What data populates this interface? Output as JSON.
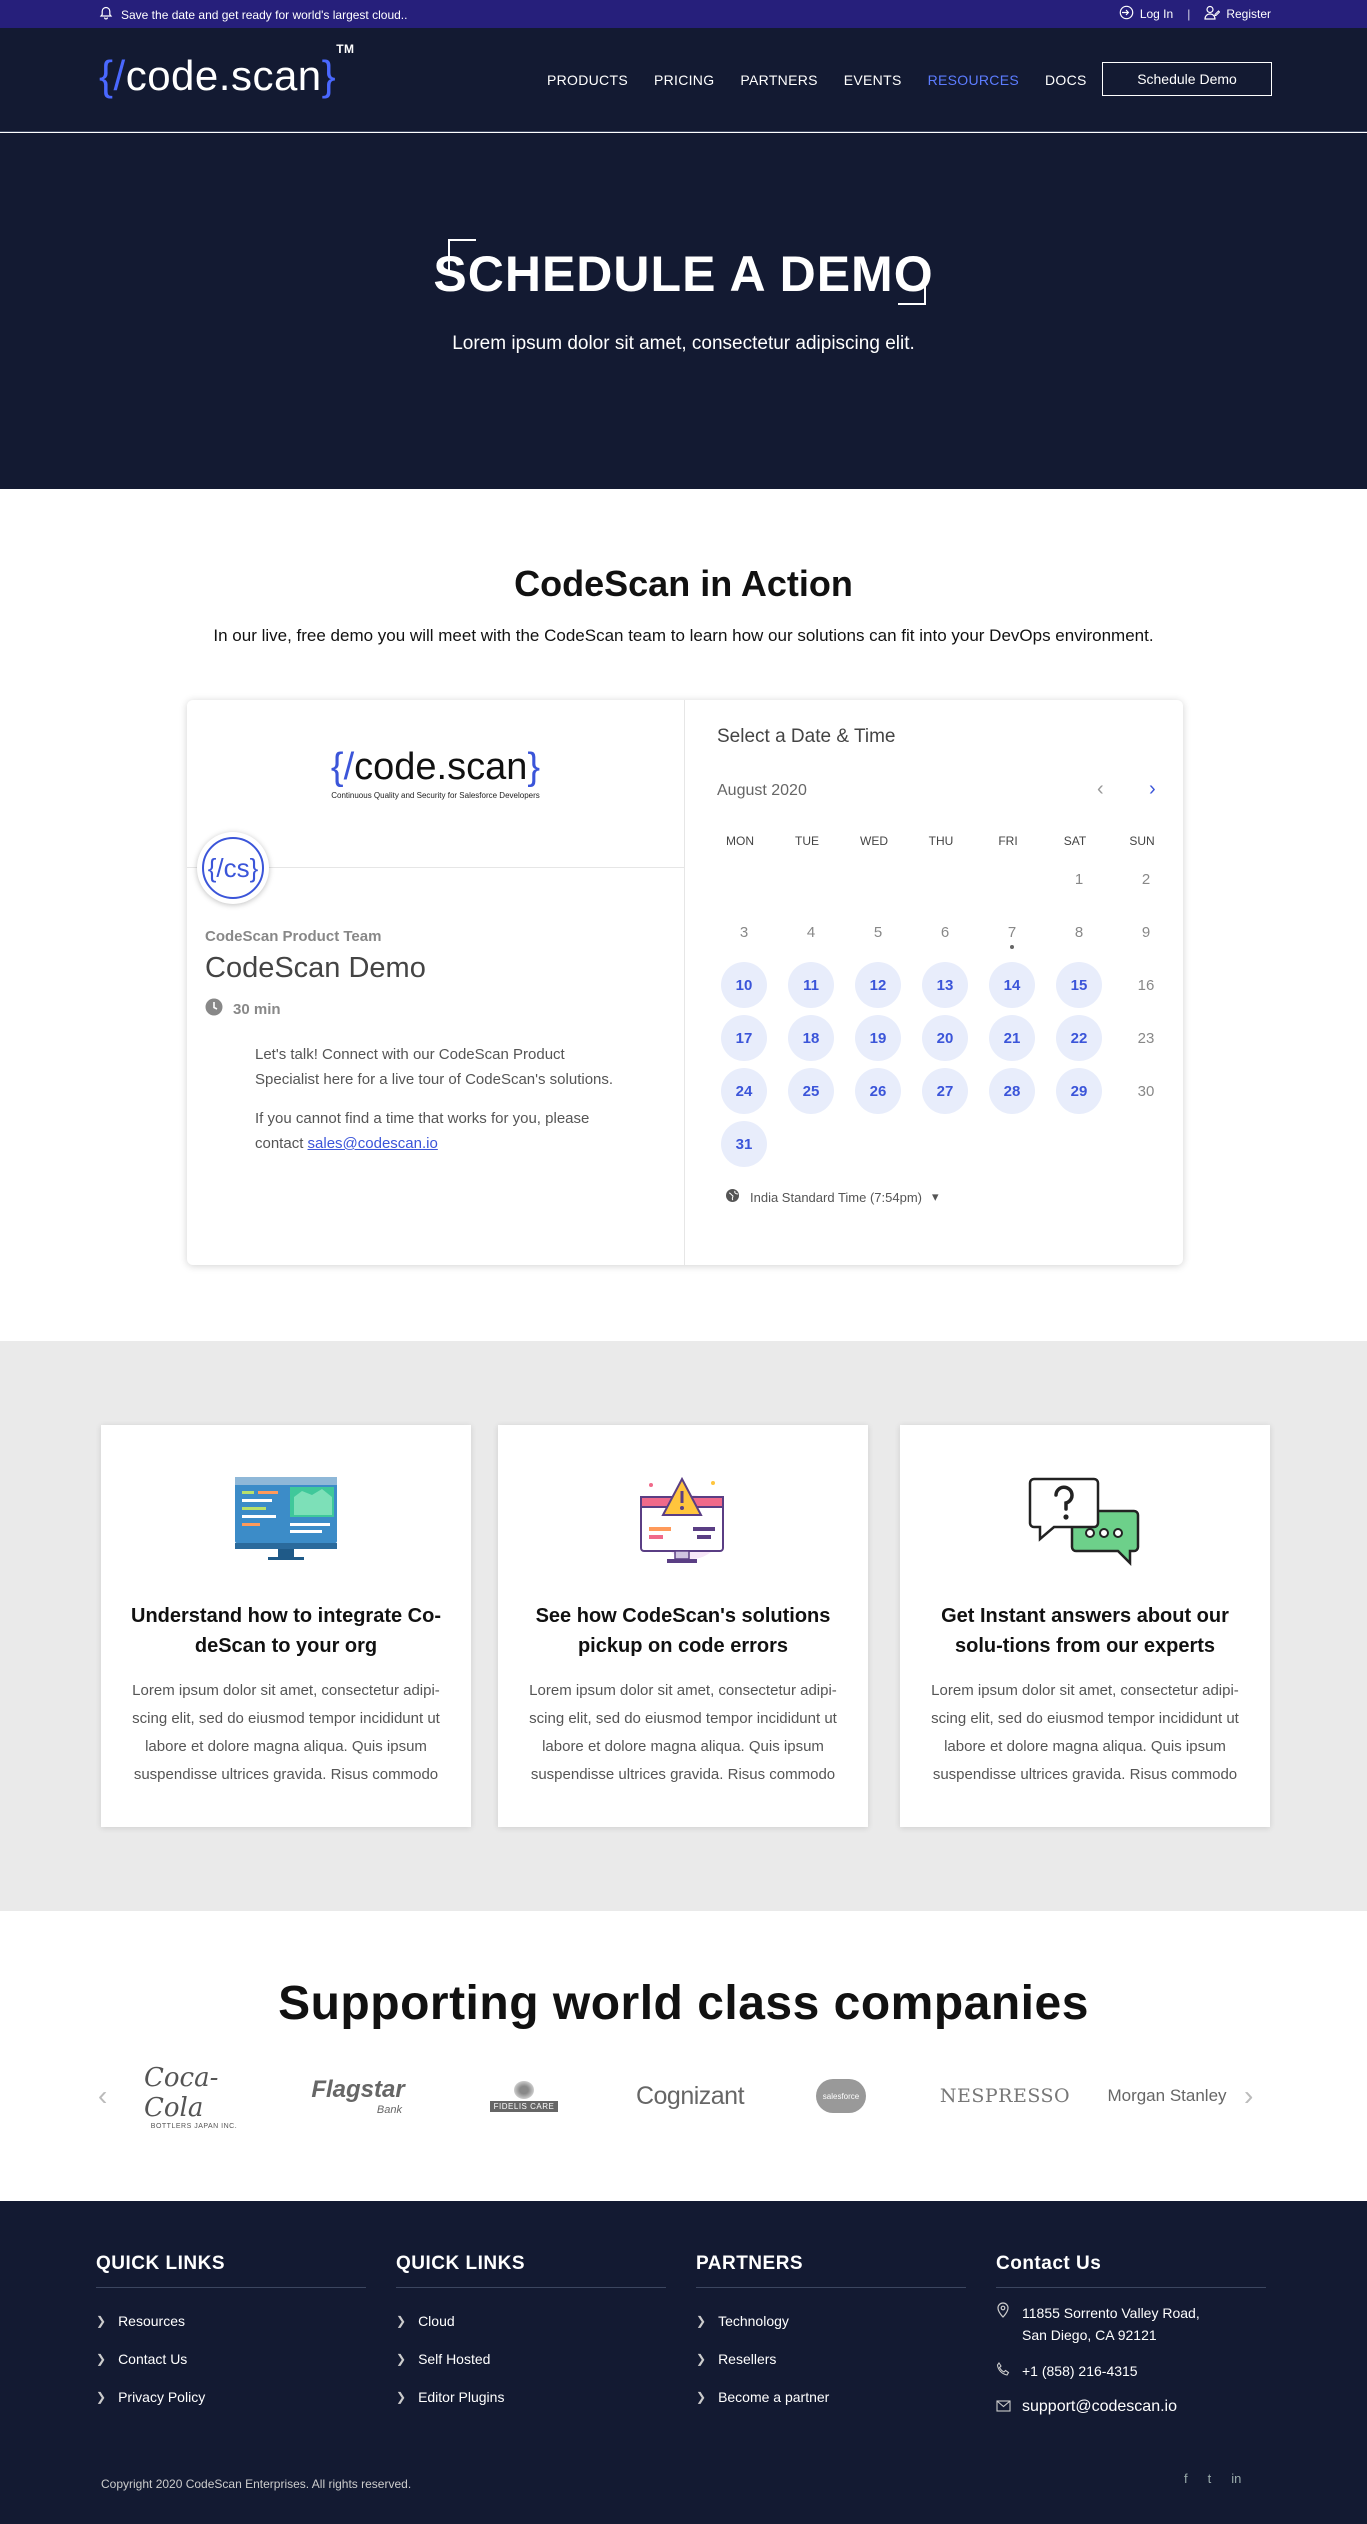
{
  "topbar": {
    "announcement": "Save the date and get ready for world's largest cloud..",
    "login": "Log In",
    "separator": "|",
    "register": "Register",
    "bg_color": "#261f7b"
  },
  "header": {
    "logo_open": "{/",
    "logo_text": "code.scan",
    "logo_close": "}",
    "logo_tm": "TM",
    "nav": [
      "PRODUCTS",
      "PRICING",
      "PARTNERS",
      "EVENTS",
      "RESOURCES",
      "DOCS"
    ],
    "active_nav": "RESOURCES",
    "cta": "Schedule Demo",
    "accent_color": "#4a68ff"
  },
  "hero": {
    "title": "SCHEDULE A DEMO",
    "subtitle": "Lorem ipsum dolor sit amet, consectetur adipiscing elit.",
    "bg_color": "#131a32"
  },
  "action": {
    "title": "CodeScan in Action",
    "subtitle": "In our live, free demo you will meet with the CodeScan team to learn how our solutions can fit into your DevOps environment."
  },
  "widget": {
    "brand_open": "{/",
    "brand_text": "code.scan",
    "brand_close": "}",
    "brand_tagline": "Continuous Quality and Security for Salesforce Developers",
    "avatar_text": "{/cs}",
    "team": "CodeScan Product Team",
    "event": "CodeScan Demo",
    "duration": "30 min",
    "desc1": "Let's talk! Connect with our CodeScan Product Specialist here for a live tour of CodeScan's solutions.",
    "desc2_prefix": "If you cannot find a time that works for you, please contact ",
    "email": "sales@codescan.io",
    "calendar": {
      "title": "Select a Date & Time",
      "month": "August 2020",
      "weekdays": [
        "MON",
        "TUE",
        "WED",
        "THU",
        "FRI",
        "SAT",
        "SUN"
      ],
      "first_weekday_index": 5,
      "days_in_month": 31,
      "available_days": [
        10,
        11,
        12,
        13,
        14,
        15,
        17,
        18,
        19,
        20,
        21,
        22,
        24,
        25,
        26,
        27,
        28,
        29,
        31
      ],
      "today": 7,
      "timezone": "India Standard Time (7:54pm)"
    }
  },
  "features": [
    {
      "icon": "monitor-code-icon",
      "title": "Understand how to integrate Co-deScan to your org",
      "text": "Lorem ipsum dolor sit amet, consectetur adipi-scing elit, sed do eiusmod tempor incididunt ut labore et dolore magna aliqua. Quis ipsum suspendisse ultrices gravida. Risus commodo"
    },
    {
      "icon": "warning-monitor-icon",
      "title": "See how CodeScan's solutions pickup on code errors",
      "text": "Lorem ipsum dolor sit amet, consectetur adipi-scing elit, sed do eiusmod tempor incididunt ut labore et dolore magna aliqua. Quis ipsum suspendisse ultrices gravida. Risus commodo"
    },
    {
      "icon": "chat-question-icon",
      "title": "Get Instant answers about our solu-tions from our experts",
      "text": "Lorem ipsum dolor sit amet, consectetur adipi-scing elit, sed do eiusmod tempor incididunt ut labore et dolore magna aliqua. Quis ipsum suspendisse ultrices gravida. Risus commodo"
    }
  ],
  "companies": {
    "title": "Supporting world class companies",
    "logos": [
      "Coca-Cola",
      "BOTTLERS JAPAN INC.",
      "Flagstar",
      "Bank",
      "FIDELIS CARE",
      "Cognizant",
      "salesforce",
      "NESPRESSO",
      "Morgan Stanley"
    ]
  },
  "footer": {
    "col1": {
      "title": "QUICK LINKS",
      "links": [
        "Resources",
        "Contact Us",
        "Privacy Policy"
      ]
    },
    "col2": {
      "title": "QUICK LINKS",
      "links": [
        "Cloud",
        "Self Hosted",
        "Editor Plugins"
      ]
    },
    "col3": {
      "title": "PARTNERS",
      "links": [
        "Technology",
        "Resellers",
        "Become a partner"
      ]
    },
    "contact": {
      "title": "Contact Us",
      "address_line1": "11855 Sorrento Valley Road,",
      "address_line2": "San Diego, CA 92121",
      "phone": "+1 (858) 216-4315",
      "email": "support@codescan.io"
    },
    "copyright": "Copyright 2020 CodeScan Enterprises. All rights reserved.",
    "social": [
      "f",
      "t",
      "in"
    ]
  }
}
